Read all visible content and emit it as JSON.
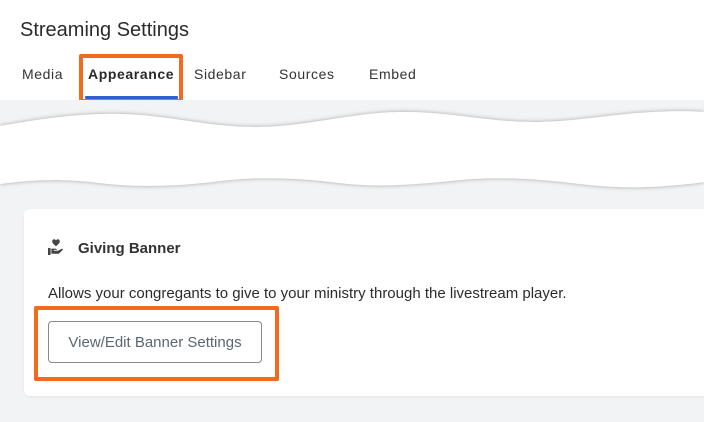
{
  "header": {
    "title": "Streaming Settings"
  },
  "tabs": [
    {
      "label": "Media",
      "active": false
    },
    {
      "label": "Appearance",
      "active": true
    },
    {
      "label": "Sidebar",
      "active": false
    },
    {
      "label": "Sources",
      "active": false
    },
    {
      "label": "Embed",
      "active": false
    }
  ],
  "card": {
    "icon": "hand-heart-icon",
    "title": "Giving Banner",
    "description": "Allows your congregants to give to your ministry through the livestream player.",
    "button_label": "View/Edit Banner Settings"
  },
  "colors": {
    "highlight": "#f26a1b",
    "tab_underline": "#2f5fd0",
    "background": "#f2f3f4"
  }
}
